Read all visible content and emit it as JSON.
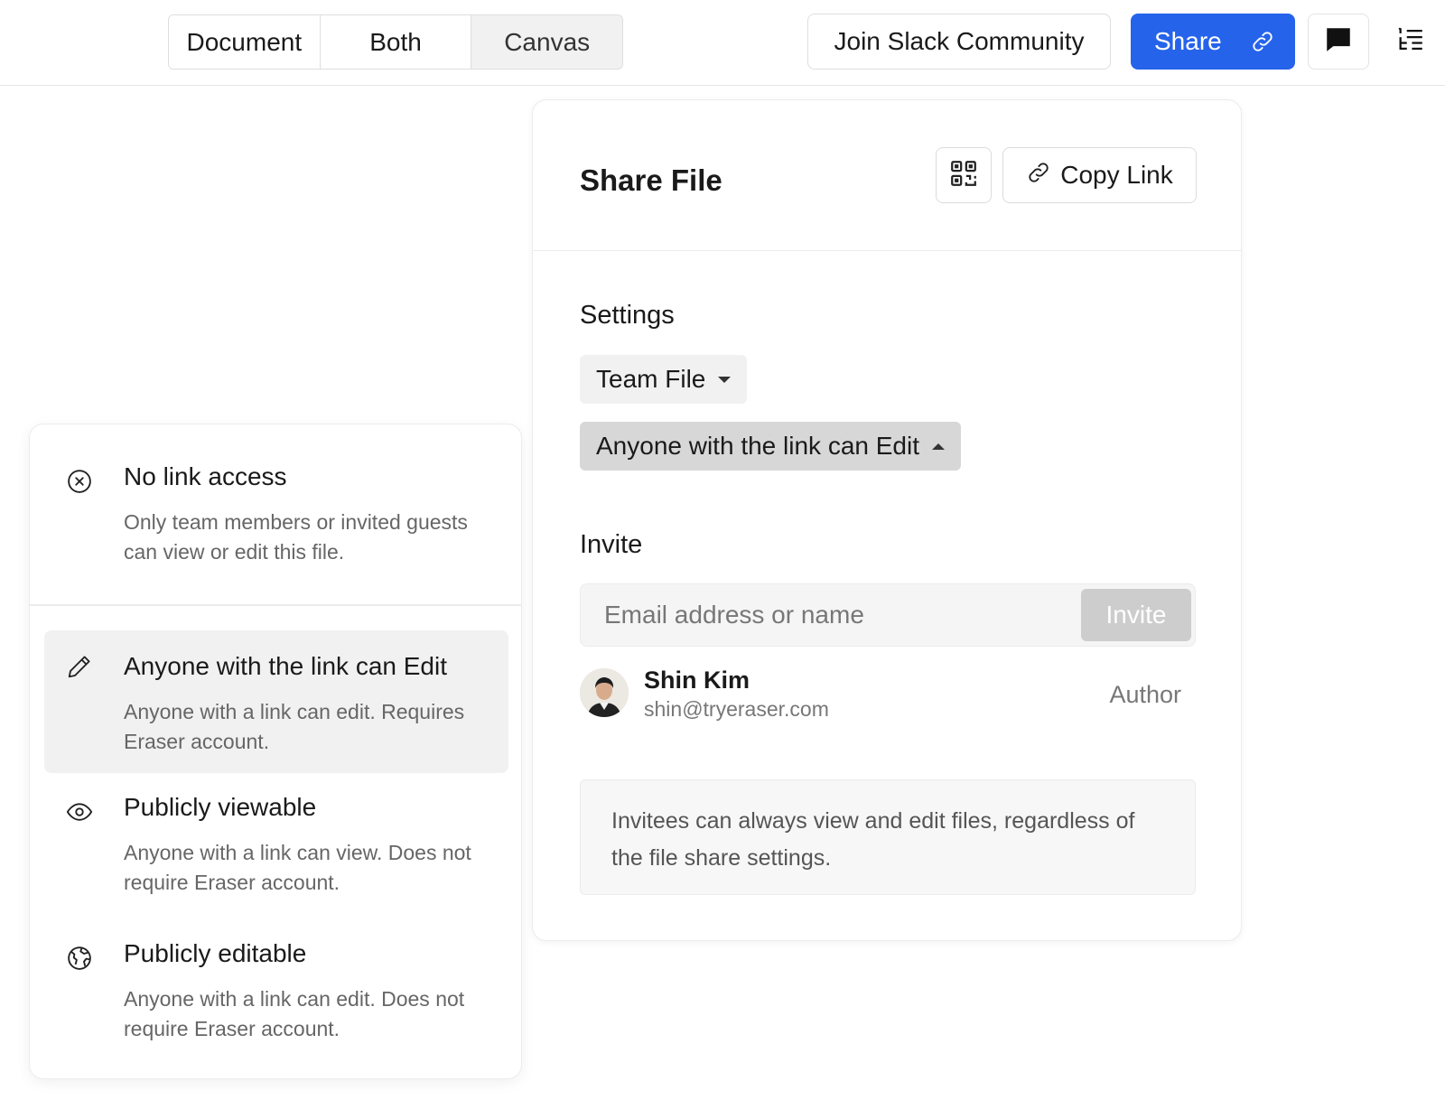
{
  "view_toggle": {
    "options": [
      "Document",
      "Both",
      "Canvas"
    ],
    "active": "Canvas"
  },
  "header": {
    "slack_label": "Join Slack Community",
    "share_label": "Share",
    "share_color": "#2563eb"
  },
  "share_panel": {
    "title": "Share File",
    "copy_link_label": "Copy Link",
    "settings_label": "Settings",
    "team_file_label": "Team File",
    "access_label": "Anyone with the link can Edit",
    "invite_label": "Invite",
    "invite_placeholder": "Email address or name",
    "invite_button": "Invite",
    "member": {
      "name": "Shin Kim",
      "email": "shin@tryeraser.com",
      "role": "Author"
    },
    "note": "Invitees can always view and edit files, regardless of the file share settings."
  },
  "access_menu": {
    "options": [
      {
        "icon": "x-circle-icon",
        "title": "No link access",
        "description": "Only team members or invited guests can view or edit this file."
      },
      {
        "icon": "pencil-icon",
        "title": "Anyone with the link can Edit",
        "description": "Anyone with a link can edit. Requires Eraser account."
      },
      {
        "icon": "eye-icon",
        "title": "Publicly viewable",
        "description": "Anyone with a link can view. Does not require Eraser account."
      },
      {
        "icon": "globe-icon",
        "title": "Publicly editable",
        "description": "Anyone with a link can edit. Does not require Eraser account."
      }
    ],
    "selected_index": 1
  }
}
